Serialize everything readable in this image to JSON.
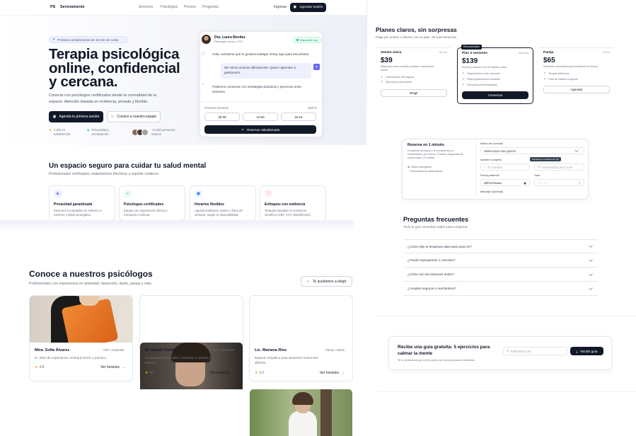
{
  "nav": {
    "logo": "PS",
    "brand": "Serenamente",
    "links": [
      "Servicios",
      "Psicólogos",
      "Precios",
      "Preguntas"
    ],
    "login": "Ingresar",
    "cta": "Agendar sesión"
  },
  "hero": {
    "badge": "Primera consulta breve de 15 min sin costo",
    "title_lines": [
      "Terapia psicológica",
      "online, confidencial",
      "y cercana."
    ],
    "subtitle_lines": [
      "Conecta con psicólogos certificados desde la comodidad de tu",
      "espacio. Atención basada en evidencia, privada y flexible."
    ],
    "primary_btn": "Agenda tu primera sesión",
    "secondary_btn": "Conoce a nuestro equipo",
    "stat1_lines": [
      "4.9/5 en",
      "satisfacción"
    ],
    "stat2_lines": [
      "Privacidad y",
      "encriptación"
    ],
    "stat3_lines": [
      "+2,000 procesos",
      "activos"
    ]
  },
  "chat": {
    "name": "Dra. Laura Benítez",
    "role": "Psicología clínica • TCC",
    "status": "Disponible hoy",
    "msg1": "Hola, cuéntame qué te gustaría trabajar. Estoy aquí para escucharte.",
    "msg2_lines": [
      "Me siento ansioso últimamente. Quiero aprender a",
      "gestionarlo."
    ],
    "msg3_lines": [
      "Podemos comenzar con estrategias prácticas y ejercicios entre",
      "sesiones."
    ],
    "slots_label": "Próximos horarios",
    "timezone": "GMT-5",
    "slots": [
      "09:30",
      "12:00",
      "16:15"
    ],
    "book_btn": "Reservar videollamada"
  },
  "safe": {
    "title": "Un espacio seguro para cuidar tu salud mental",
    "subtitle": "Profesionales verificados, tratamientos efectivos y soporte continuo.",
    "features": [
      {
        "title": "Privacidad garantizada",
        "desc_lines": [
          "Sesiones encriptadas de extremo a",
          "extremo y datos protegidos."
        ]
      },
      {
        "title": "Psicólogos certificados",
        "desc_lines": [
          "Equipo con experiencia clínica y",
          "formación continua."
        ]
      },
      {
        "title": "Horarios flexibles",
        "desc_lines": [
          "Agenda mañanas, tardes o fines de",
          "semana, según tu disponibilidad."
        ]
      },
      {
        "title": "Enfoques con evidencia",
        "desc_lines": [
          "Terapias basadas en evidencia",
          "científica (CBT, ACT, Mindfulness)."
        ]
      }
    ]
  },
  "team": {
    "title": "Conoce a nuestros psicólogos",
    "subtitle": "Profesionales con experiencia en ansiedad, depresión, duelo, pareja y más.",
    "help_btn": "Te ayudamos a elegir",
    "schedule_label": "Ver horarios",
    "cards": [
      {
        "name": "Mtra. Sofía Álvarez",
        "tag": "CBT • Ansiedad",
        "desc_lines": [
          "8+ años de experiencia. Enfoque breve y práctico."
        ],
        "rating": "4.8"
      },
      {
        "name": "Dr. Daniel Cortés",
        "tag": "ACT • Depresión",
        "desc_lines": [
          "Acompañamiento cálido orientado a valores y",
          "hábitos."
        ],
        "rating": "4.9"
      },
      {
        "name": "Lic. Mariana Ríos",
        "tag": "Pareja • Duelo",
        "desc_lines": [
          "Espacio empático para atravesar momentos",
          "difíciles."
        ],
        "rating": "5.0"
      }
    ]
  },
  "pricing": {
    "title": "Planes claros, sin sorpresas",
    "subtitle": "Paga por sesión o ahorra con un plan. Sin permanencia.",
    "recommended": "Recomendado",
    "plans": [
      {
        "name": "Sesión única",
        "duration": "60 min",
        "price": "$39",
        "desc_lines": [
          "Ideal para una consulta puntual o evaluación",
          "inicial."
        ],
        "features": [
          "Videosesión HD segura",
          "Ejercicios post-sesión"
        ],
        "button": "Elegir"
      },
      {
        "name": "Plan 4 sesiones",
        "duration": "Mensual",
        "price": "$139",
        "desc_lines": [
          "Ahorra y avanza con un objetivo claro."
        ],
        "features": [
          "Seguimiento entre sesiones",
          "Reprogramaciones flexibles",
          "Recursos personalizados"
        ],
        "button": "Comenzar"
      },
      {
        "name": "Pareja",
        "duration": "75 min",
        "price": "$65",
        "desc_lines": [
          "Sesiones orientadas para fortalecer el vínculo."
        ],
        "features": [
          "Terapia sistémica",
          "Plan de hábitos conjunto"
        ],
        "button": "Agendar"
      }
    ]
  },
  "booking": {
    "title": "Reserva en 1 minuto",
    "desc_lines": [
      "Completa tus datos y te enviaremos la",
      "confirmación por correo. Puedes reagendar sin",
      "costo hasta 12 h antes."
    ],
    "bullets": [
      "Datos protegidos",
      "Recordatorios automáticos"
    ],
    "reason_label": "Motivo de consulta",
    "reason_value": "Selecciona una opción",
    "name_label": "Nombre completo",
    "name_placeholder": "Tu nombre",
    "email_placeholder": "tucorreo@correo.com",
    "tooltip": "Introduce un símbolo de \"@\"",
    "date_label": "Fecha preferida",
    "date_value": "dd/mm/aaaa",
    "time_label": "Hora",
    "time_value": "--:-- ----",
    "message_label": "Mensaje (opcional)"
  },
  "faq": {
    "title": "Preguntas frecuentes",
    "subtitle": "Todo lo que necesitas saber para empezar.",
    "items": [
      "¿Cómo elijo al terapeuta adecuado para mí?",
      "¿Puedo reprogramar o cancelar?",
      "¿Cómo son las sesiones online?",
      "¿Aceptan seguros o reembolsos?"
    ]
  },
  "newsletter": {
    "title_lines": [
      "Recibe una guía gratuita: 5 ejercicios para",
      "calmar la mente"
    ],
    "subtitle": "Te la enviaremos por correo junto con recursos para tu bienestar.",
    "email_placeholder": "tu@email.com",
    "button": "Recibir guía"
  },
  "colors": {
    "accent": "#6366f1",
    "dark": "#111827",
    "star": "#f59e0b",
    "orange": "#e8741d"
  }
}
